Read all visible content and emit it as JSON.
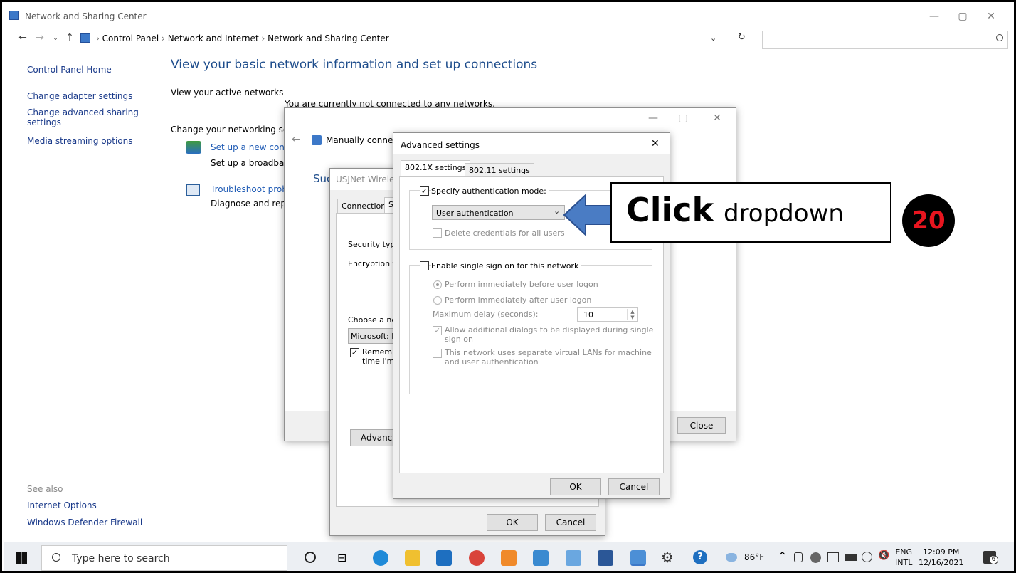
{
  "window": {
    "title": "Network and Sharing Center",
    "controls": [
      "—",
      "▢",
      "✕"
    ]
  },
  "address": {
    "crumbs": [
      "Control Panel",
      "Network and Internet",
      "Network and Sharing Center"
    ],
    "separator": "›",
    "search_placeholder": ""
  },
  "sidebar": {
    "home": "Control Panel Home",
    "items": [
      "Change adapter settings",
      "Change advanced sharing settings",
      "Media streaming options"
    ],
    "see_also_label": "See also",
    "see_also": [
      "Internet Options",
      "Windows Defender Firewall"
    ]
  },
  "main": {
    "heading": "View your basic network information and set up connections",
    "active_networks_label": "View your active networks",
    "not_connected": "You are currently not connected to any networks.",
    "change_settings_label": "Change your networking sett",
    "setup_link": "Set up a new conne",
    "setup_desc": "Set up a broadbanc",
    "troubleshoot_link": "Troubleshoot probl",
    "troubleshoot_desc": "Diagnose and repai"
  },
  "manual_connect": {
    "title": "Manually connec",
    "success_fragment": "Suc",
    "close_button": "Close",
    "controls": [
      "—",
      "▢",
      "✕"
    ]
  },
  "wireless_props": {
    "title": "USJNet Wireles",
    "tabs": [
      "Connection",
      "S"
    ],
    "security_type": "Security type",
    "encryption_type": "Encryption ty",
    "choose_method": "Choose a net",
    "method_value": "Microsoft: Pr",
    "remember_line1": "Remembe",
    "remember_line2": "time I'm lo",
    "advanced_button": "Advanced",
    "ok": "OK",
    "cancel": "Cancel"
  },
  "advanced": {
    "title": "Advanced settings",
    "close": "✕",
    "tabs": [
      "802.1X settings",
      "802.11 settings"
    ],
    "specify_auth": "Specify authentication mode:",
    "auth_value": "User authentication",
    "delete_credentials": "Delete credentials for all users",
    "enable_sso": "Enable single sign on for this network",
    "perform_before": "Perform immediately before user logon",
    "perform_after": "Perform immediately after user logon",
    "max_delay_label": "Maximum delay (seconds):",
    "max_delay_value": "10",
    "allow_dialogs_1": "Allow additional dialogs to be displayed during single",
    "allow_dialogs_2": "sign on",
    "separate_vlans_1": "This network uses separate virtual LANs for machine",
    "separate_vlans_2": "and user authentication",
    "ok": "OK",
    "cancel": "Cancel"
  },
  "annotation": {
    "bold_word": "Click",
    "word": "dropdown",
    "step": "20",
    "arrow_color": "#4a7cc4"
  },
  "taskbar": {
    "search_placeholder": "Type here to search",
    "weather": "86°F",
    "lang_top": "ENG",
    "lang_bottom": "INTL",
    "time": "12:09 PM",
    "date": "12/16/2021",
    "notifications": "6"
  }
}
